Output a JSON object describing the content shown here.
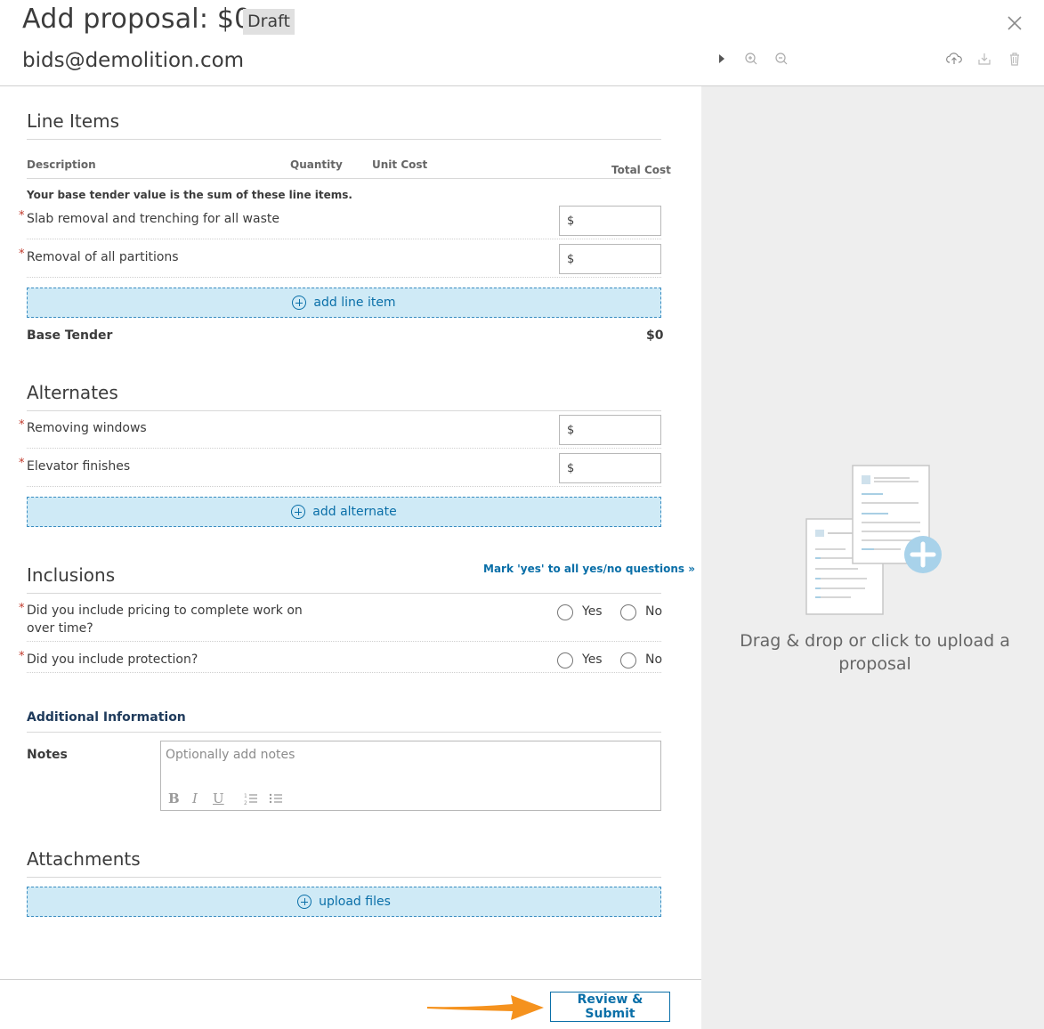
{
  "header": {
    "title": "Add proposal: $0",
    "status_badge": "Draft",
    "email": "bids@demolition.com"
  },
  "line_items": {
    "title": "Line Items",
    "columns": [
      "Description",
      "Quantity",
      "Unit Cost",
      "Total Cost"
    ],
    "note": "Your base tender value is the sum of these line items.",
    "items": [
      {
        "label": "Slab removal and trenching for all waste",
        "value": "$"
      },
      {
        "label": "Removal of all partitions",
        "value": "$"
      }
    ],
    "add_label": "add line item",
    "base_tender_label": "Base Tender",
    "base_tender_value": "$0"
  },
  "alternates": {
    "title": "Alternates",
    "items": [
      {
        "label": "Removing windows",
        "value": "$"
      },
      {
        "label": "Elevator finishes",
        "value": "$"
      }
    ],
    "add_label": "add alternate"
  },
  "inclusions": {
    "title": "Inclusions",
    "mark_all_link": "Mark 'yes' to all yes/no questions »",
    "questions": [
      {
        "line1": "Did you include pricing to complete work on",
        "line2": "over time?",
        "yes": "Yes",
        "no": "No"
      },
      {
        "line1": "Did you include protection?",
        "line2": "",
        "yes": "Yes",
        "no": "No"
      }
    ]
  },
  "additional": {
    "title": "Additional Information",
    "notes_label": "Notes",
    "notes_placeholder": "Optionally add notes",
    "notes_value": ""
  },
  "attachments": {
    "title": "Attachments",
    "upload_label": "upload files"
  },
  "footer": {
    "submit_label": "Review & Submit"
  },
  "dropzone": {
    "line1": "Drag & drop or click to upload a",
    "line2": "proposal"
  },
  "colors": {
    "accent": "#0a6fa8",
    "add_button_bg": "#cfeaf6",
    "right_panel_bg": "#eeeeee",
    "arrow": "#f5921e"
  }
}
